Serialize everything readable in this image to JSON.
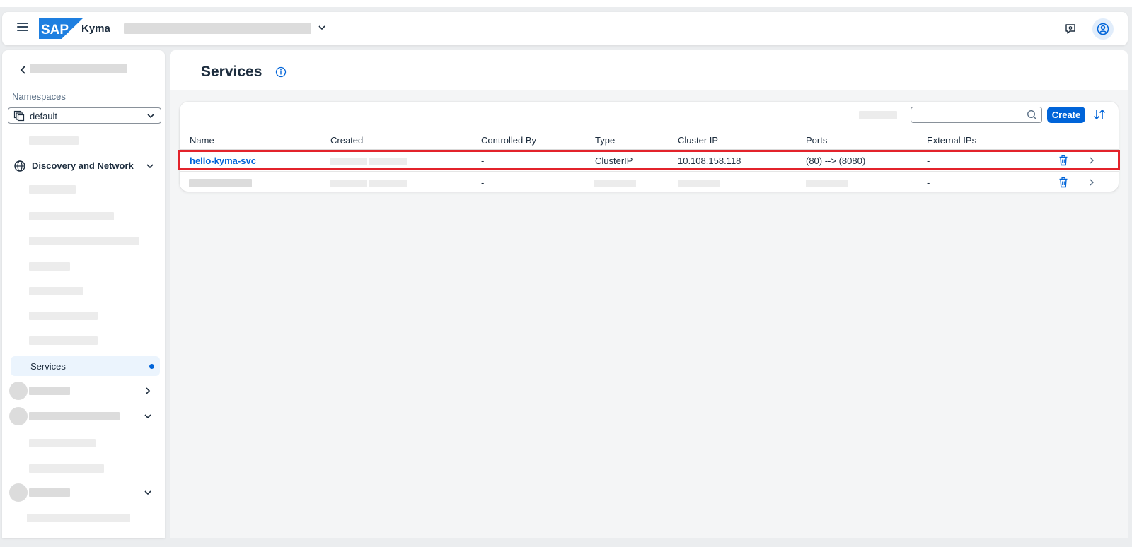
{
  "shell": {
    "menu_icon": "hamburger-icon",
    "logo_text": "SAP",
    "product_name": "Kyma",
    "feedback_icon": "feedback-icon",
    "user_icon": "user-icon"
  },
  "sidebar": {
    "namespaces_label": "Namespaces",
    "namespace_value": "default",
    "group_title": "Discovery and Network",
    "selected_item": "Services"
  },
  "main": {
    "title": "Services",
    "search_placeholder": "",
    "create_label": "Create",
    "columns": [
      "Name",
      "Created",
      "Controlled By",
      "Type",
      "Cluster IP",
      "Ports",
      "External IPs"
    ],
    "rows": [
      {
        "name": "hello-kyma-svc",
        "controlled_by": "-",
        "type": "ClusterIP",
        "cluster_ip": "10.108.158.118",
        "ports": "(80) --> (8080)",
        "external_ips": "-"
      },
      {
        "name": "",
        "controlled_by": "-",
        "type": "",
        "cluster_ip": "",
        "ports": "",
        "external_ips": "-"
      }
    ]
  },
  "colors": {
    "accent": "#0064d9",
    "highlight": "#e3232b"
  }
}
